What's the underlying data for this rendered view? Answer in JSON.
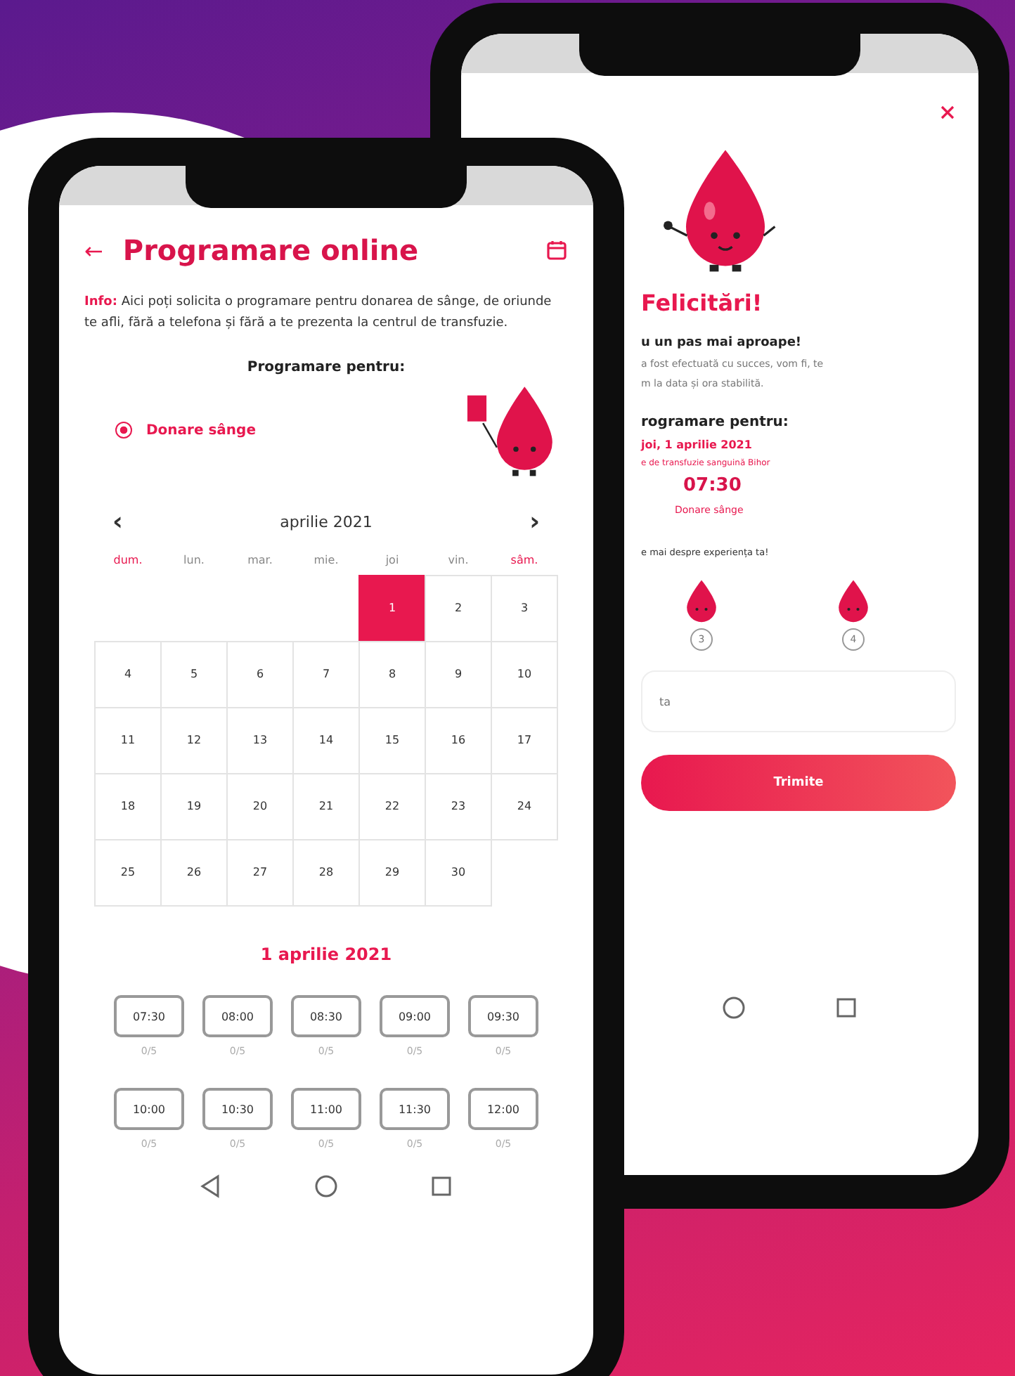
{
  "left_phone": {
    "header": {
      "back": "←",
      "title": "Programare online"
    },
    "info": {
      "label": "Info:",
      "text": "Aici poți solicita o programare pentru donarea de sânge, de oriunde te afli, fără a telefona și fără a te prezenta la centrul de transfuzie."
    },
    "section_title": "Programare pentru:",
    "options": [
      {
        "label": "Donare sânge",
        "selected": true
      }
    ],
    "calendar": {
      "prev": "‹",
      "month": "aprilie 2021",
      "next": "›",
      "weekdays": [
        {
          "label": "dum.",
          "weekend": true
        },
        {
          "label": "lun.",
          "weekend": false
        },
        {
          "label": "mar.",
          "weekend": false
        },
        {
          "label": "mie.",
          "weekend": false
        },
        {
          "label": "joi",
          "weekend": false
        },
        {
          "label": "vin.",
          "weekend": false
        },
        {
          "label": "sâm.",
          "weekend": true
        }
      ],
      "weeks": [
        [
          {
            "day": "1",
            "selected": true
          },
          {
            "day": "2",
            "selected": false
          },
          {
            "day": "3",
            "selected": false
          }
        ],
        [
          {
            "day": "4",
            "selected": false
          },
          {
            "day": "5",
            "selected": false
          },
          {
            "day": "6",
            "selected": false
          },
          {
            "day": "7",
            "selected": false
          },
          {
            "day": "8",
            "selected": false
          },
          {
            "day": "9",
            "selected": false
          },
          {
            "day": "10",
            "selected": false
          }
        ],
        [
          {
            "day": "11",
            "selected": false
          },
          {
            "day": "12",
            "selected": false
          },
          {
            "day": "13",
            "selected": false
          },
          {
            "day": "14",
            "selected": false
          },
          {
            "day": "15",
            "selected": false
          },
          {
            "day": "16",
            "selected": false
          },
          {
            "day": "17",
            "selected": false
          }
        ],
        [
          {
            "day": "18",
            "selected": false
          },
          {
            "day": "19",
            "selected": false
          },
          {
            "day": "20",
            "selected": false
          },
          {
            "day": "21",
            "selected": false
          },
          {
            "day": "22",
            "selected": false
          },
          {
            "day": "23",
            "selected": false
          },
          {
            "day": "24",
            "selected": false
          }
        ],
        [
          {
            "day": "25",
            "selected": false
          },
          {
            "day": "26",
            "selected": false
          },
          {
            "day": "27",
            "selected": false
          },
          {
            "day": "28",
            "selected": false
          },
          {
            "day": "29",
            "selected": false
          },
          {
            "day": "30",
            "selected": false
          }
        ]
      ]
    },
    "date_title": "1 aprilie 2021",
    "slots": [
      {
        "time": "07:30",
        "count": "0/5"
      },
      {
        "time": "08:00",
        "count": "0/5"
      },
      {
        "time": "08:30",
        "count": "0/5"
      },
      {
        "time": "09:00",
        "count": "0/5"
      },
      {
        "time": "09:30",
        "count": "0/5"
      },
      {
        "time": "10:00",
        "count": "0/5"
      },
      {
        "time": "10:30",
        "count": "0/5"
      },
      {
        "time": "11:00",
        "count": "0/5"
      },
      {
        "time": "11:30",
        "count": "0/5"
      },
      {
        "time": "12:00",
        "count": "0/5"
      }
    ]
  },
  "right_phone": {
    "title": "Felicitări!",
    "subtitle": "u un pas mai aproape!",
    "message_lines": [
      "a fost efectuată cu succes, vom fi, te",
      "m la data și ora stabilită."
    ],
    "appointment_label": "rogramare pentru:",
    "date": "joi, 1 aprilie 2021",
    "center": "e de transfuzie sanguină Bihor",
    "time": "07:30",
    "service": "Donare sânge",
    "feedback_prompt": "e mai despre experiența ta!",
    "ratings": [
      {
        "label": "3"
      },
      {
        "label": "4"
      }
    ],
    "comment_placeholder": "ta",
    "submit": "Trimite"
  }
}
